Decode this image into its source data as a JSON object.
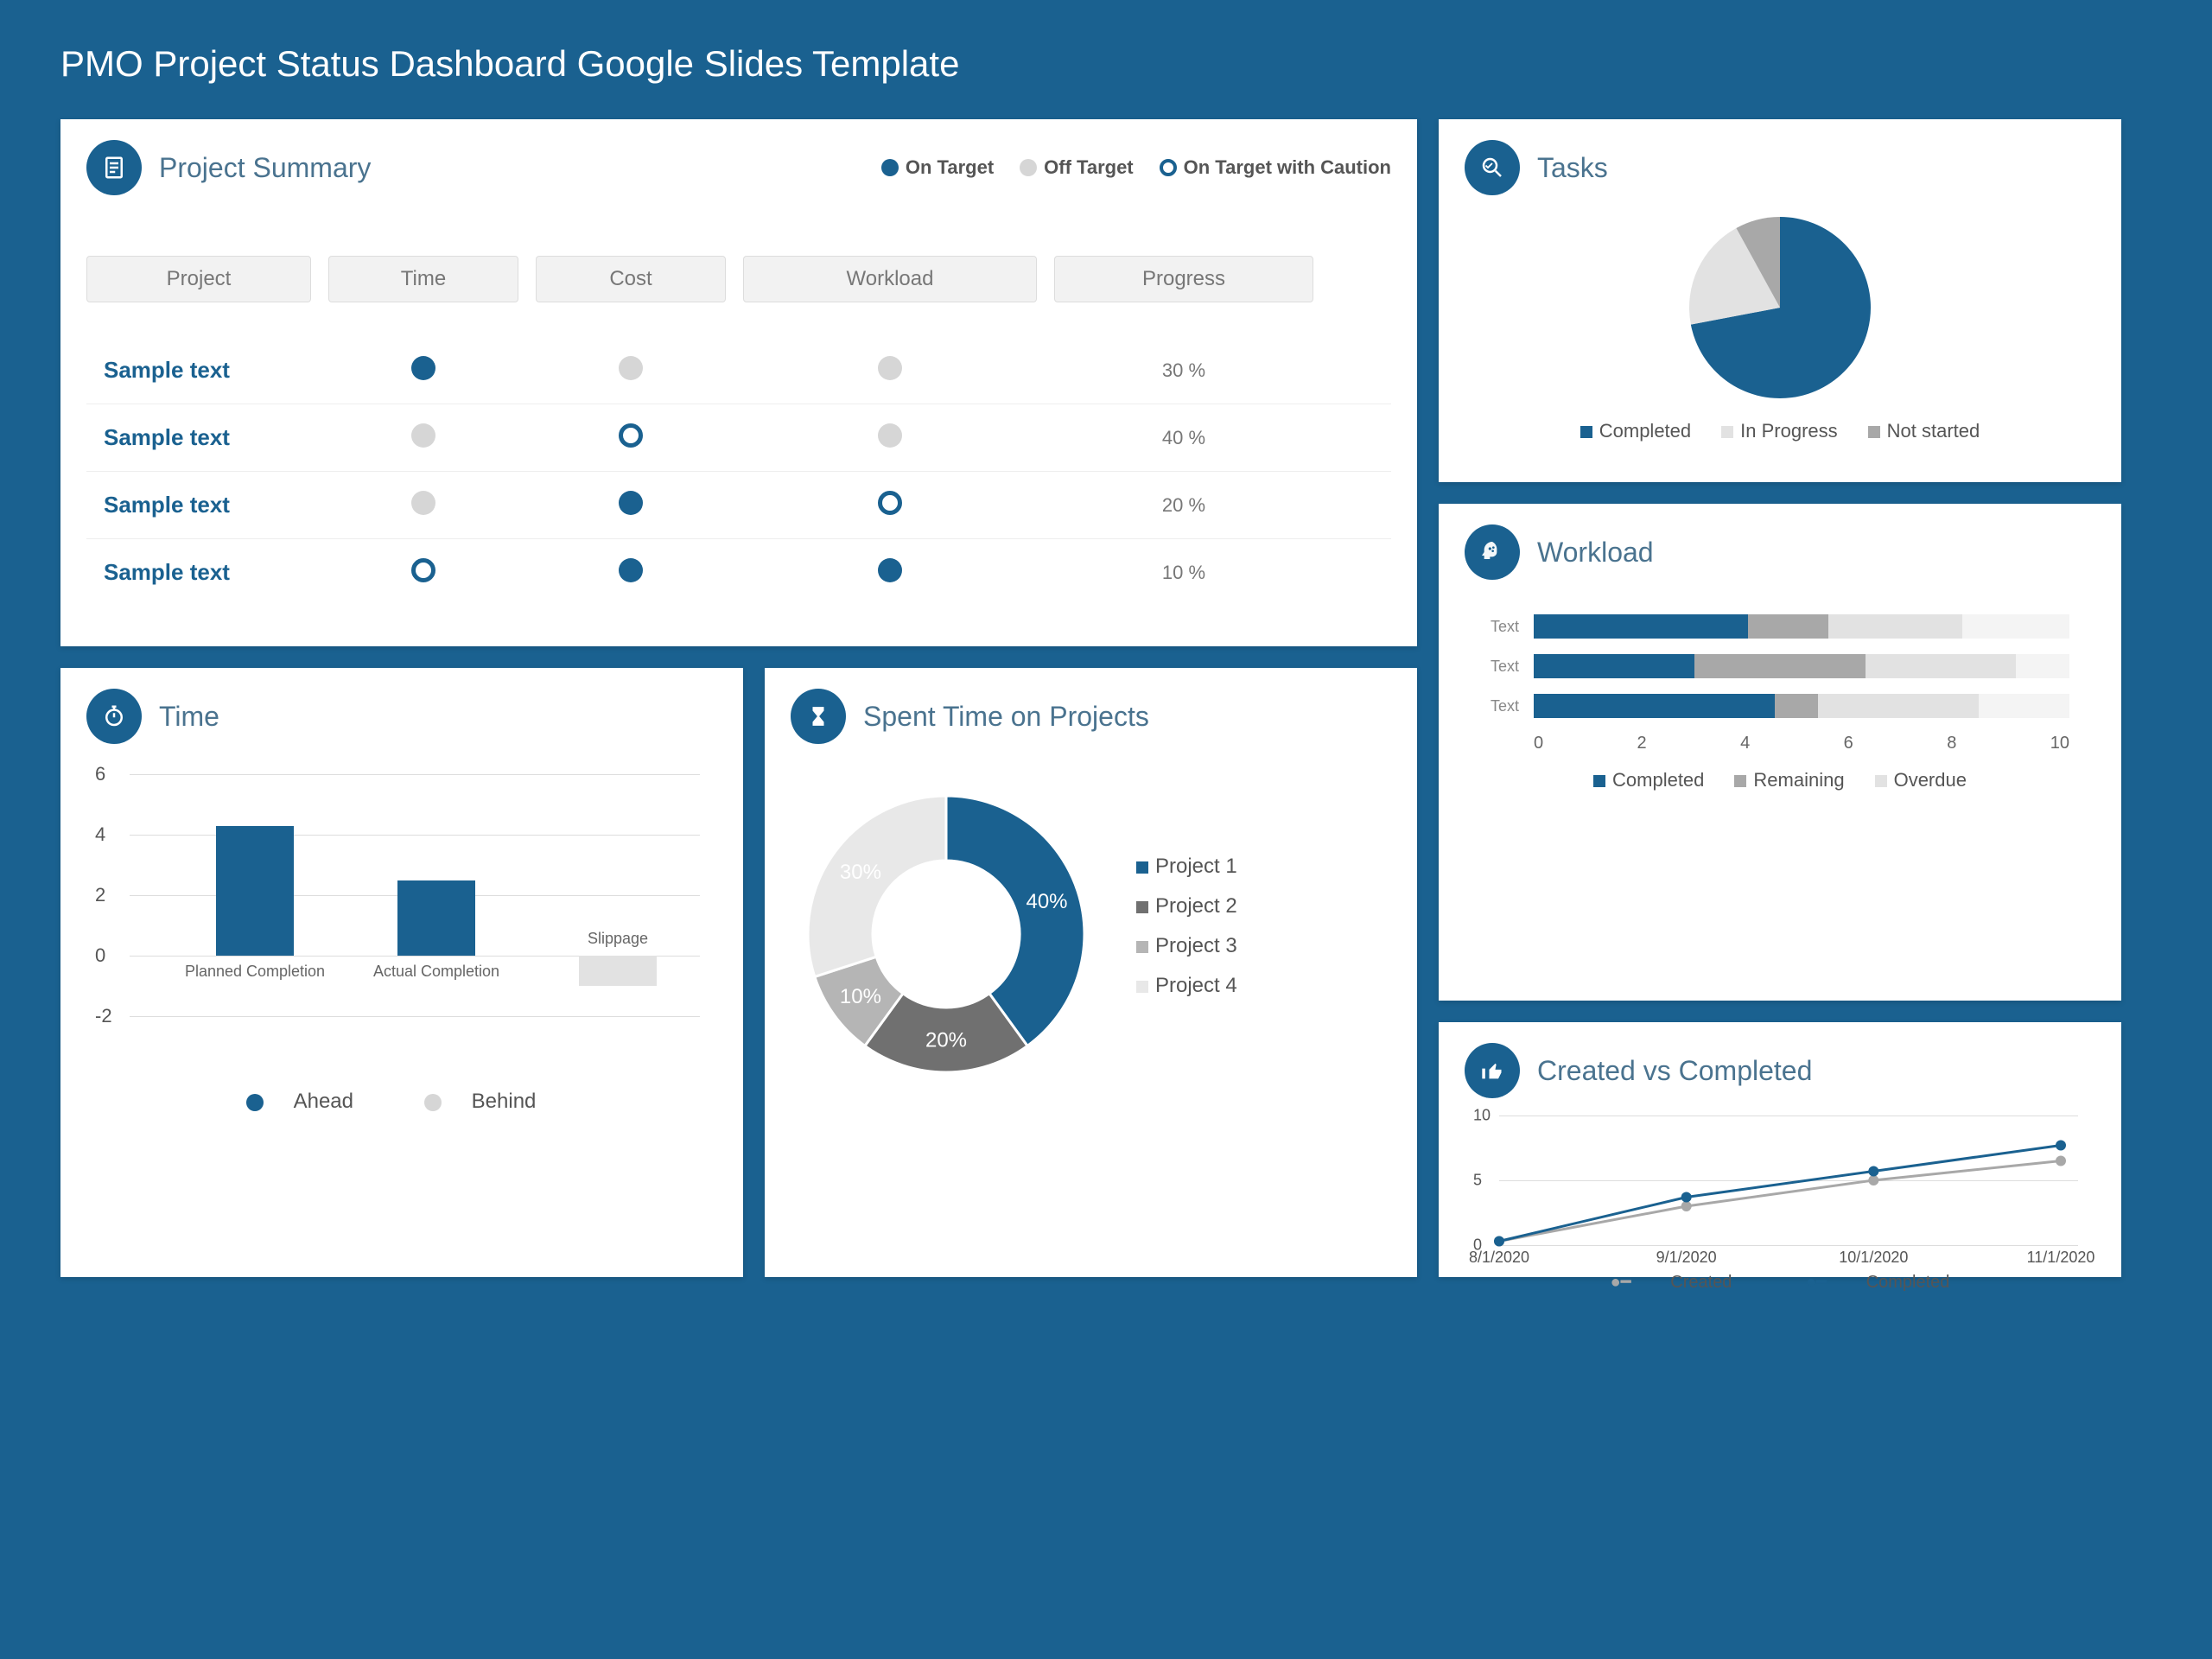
{
  "title": "PMO Project Status Dashboard Google Slides Template",
  "colors": {
    "primary": "#1a6190",
    "grey": "#a8a8a8",
    "light": "#e2e2e2"
  },
  "summary": {
    "title": "Project Summary",
    "legend": {
      "on": "On Target",
      "off": "Off Target",
      "caution": "On Target with Caution"
    },
    "headers": [
      "Project",
      "Time",
      "Cost",
      "Workload",
      "Progress"
    ],
    "rows": [
      {
        "name": "Sample text",
        "time": "on",
        "cost": "off",
        "workload": "off",
        "progress": "30 %"
      },
      {
        "name": "Sample text",
        "time": "off",
        "cost": "caution",
        "workload": "off",
        "progress": "40 %"
      },
      {
        "name": "Sample text",
        "time": "off",
        "cost": "on",
        "workload": "caution",
        "progress": "20 %"
      },
      {
        "name": "Sample text",
        "time": "caution",
        "cost": "on",
        "workload": "on",
        "progress": "10 %"
      }
    ]
  },
  "tasks": {
    "title": "Tasks",
    "legend": [
      "Completed",
      "In Progress",
      "Not started"
    ]
  },
  "workload": {
    "title": "Workload",
    "rows": [
      {
        "label": "Text"
      },
      {
        "label": "Text"
      },
      {
        "label": "Text"
      }
    ],
    "ticks": [
      "0",
      "2",
      "4",
      "6",
      "8",
      "10"
    ],
    "legend": [
      "Completed",
      "Remaining",
      "Overdue"
    ]
  },
  "time": {
    "title": "Time",
    "y_ticks": [
      "6",
      "4",
      "2",
      "0",
      "-2"
    ],
    "bars": [
      {
        "label": "Planned Completion"
      },
      {
        "label": "Actual Completion"
      },
      {
        "label": "Slippage"
      }
    ],
    "legend": [
      "Ahead",
      "Behind"
    ]
  },
  "spent": {
    "title": "Spent Time on Projects",
    "slice_labels": [
      "40%",
      "20%",
      "10%",
      "30%"
    ],
    "legend": [
      "Project 1",
      "Project 2",
      "Project 3",
      "Project 4"
    ]
  },
  "created": {
    "title": "Created vs Completed",
    "y_ticks": [
      "10",
      "5",
      "0"
    ],
    "x_ticks": [
      "8/1/2020",
      "9/1/2020",
      "10/1/2020",
      "11/1/2020"
    ],
    "legend": [
      "Created",
      "Completed"
    ]
  },
  "chart_data": [
    {
      "type": "pie",
      "title": "Tasks",
      "categories": [
        "Completed",
        "In Progress",
        "Not started"
      ],
      "values": [
        72,
        20,
        8
      ]
    },
    {
      "type": "bar",
      "title": "Workload",
      "orientation": "horizontal",
      "stacked": true,
      "categories": [
        "Text",
        "Text",
        "Text"
      ],
      "series": [
        {
          "name": "Completed",
          "values": [
            4.0,
            3.0,
            4.5
          ]
        },
        {
          "name": "Remaining",
          "values": [
            1.5,
            3.2,
            0.8
          ]
        },
        {
          "name": "Overdue",
          "values": [
            2.5,
            2.8,
            3.0
          ]
        }
      ],
      "xlim": [
        0,
        10
      ]
    },
    {
      "type": "bar",
      "title": "Time",
      "categories": [
        "Planned Completion",
        "Actual Completion",
        "Slippage"
      ],
      "values": [
        4.3,
        2.5,
        -1.0
      ],
      "ylim": [
        -2,
        6
      ],
      "series_legend": [
        "Ahead",
        "Behind"
      ]
    },
    {
      "type": "pie",
      "title": "Spent Time on Projects",
      "categories": [
        "Project 1",
        "Project 2",
        "Project 3",
        "Project 4"
      ],
      "values": [
        40,
        20,
        10,
        30
      ],
      "donut": true
    },
    {
      "type": "line",
      "title": "Created vs Completed",
      "x": [
        "8/1/2020",
        "9/1/2020",
        "10/1/2020",
        "11/1/2020"
      ],
      "series": [
        {
          "name": "Created",
          "values": [
            0.3,
            3.0,
            5.0,
            6.5
          ]
        },
        {
          "name": "Completed",
          "values": [
            0.3,
            3.7,
            5.7,
            7.7
          ]
        }
      ],
      "ylim": [
        0,
        10
      ]
    }
  ]
}
